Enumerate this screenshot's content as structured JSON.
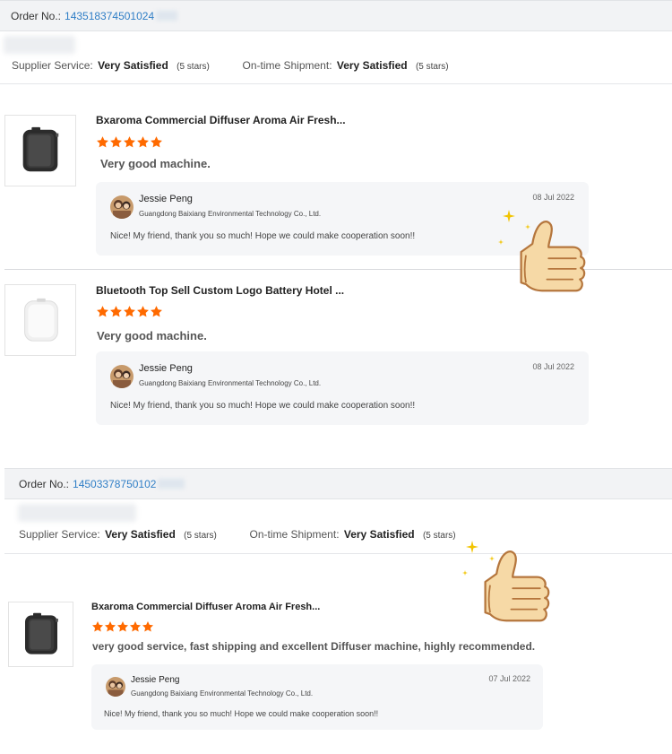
{
  "orders": [
    {
      "order_label": "Order No.:",
      "order_number": "143518374501024",
      "supplier_service_label": "Supplier Service:",
      "supplier_service_value": "Very Satisfied",
      "supplier_service_stars": "(5 stars)",
      "shipment_label": "On-time Shipment:",
      "shipment_value": "Very Satisfied",
      "shipment_stars": "(5 stars)",
      "items": [
        {
          "title": "Bxaroma Commercial Diffuser Aroma Air Fresh...",
          "rating": 5,
          "review": "Very good machine.",
          "reply": {
            "name": "Jessie Peng",
            "company": "Guangdong Baixiang Environmental Technology Co., Ltd.",
            "date": "08 Jul 2022",
            "message": "Nice! My friend, thank you so much! Hope we could make cooperation soon!!"
          }
        },
        {
          "title": "Bluetooth Top Sell Custom Logo Battery Hotel ...",
          "rating": 5,
          "review": "Very good machine.",
          "reply": {
            "name": "Jessie Peng",
            "company": "Guangdong Baixiang Environmental Technology Co., Ltd.",
            "date": "08 Jul 2022",
            "message": "Nice! My friend, thank you so much! Hope we could make cooperation soon!!"
          }
        }
      ]
    },
    {
      "order_label": "Order No.:",
      "order_number": "14503378750102",
      "supplier_service_label": "Supplier Service:",
      "supplier_service_value": "Very Satisfied",
      "supplier_service_stars": "(5 stars)",
      "shipment_label": "On-time Shipment:",
      "shipment_value": "Very Satisfied",
      "shipment_stars": "(5 stars)",
      "items": [
        {
          "title": "Bxaroma Commercial Diffuser Aroma Air Fresh...",
          "rating": 5,
          "review": "very good service, fast shipping and excellent Diffuser machine, highly recommended.",
          "reply": {
            "name": "Jessie Peng",
            "company": "Guangdong Baixiang Environmental Technology Co., Ltd.",
            "date": "07 Jul 2022",
            "message": "Nice! My friend, thank you so much! Hope we could make cooperation soon!!"
          }
        }
      ]
    }
  ],
  "colors": {
    "link_blue": "#2f7ec6",
    "star_orange": "#ff6a00",
    "header_bg": "#f2f3f5",
    "reply_bg": "#f5f6f8"
  },
  "icons": {
    "thumbs_up": "thumbs-up-icon",
    "star": "star-icon",
    "diffuser_black": "black-diffuser-product-image",
    "diffuser_white": "white-diffuser-product-image"
  }
}
